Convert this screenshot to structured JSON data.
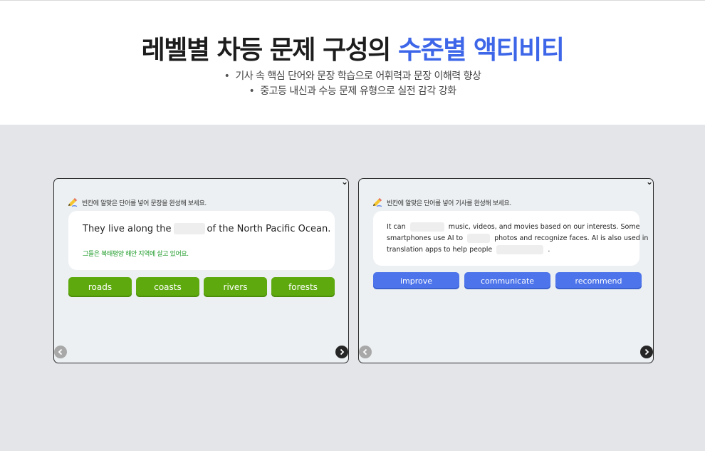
{
  "header": {
    "title_main": "레벨별 차등 문제 구성의",
    "title_accent": "수준별 액티비티",
    "bullets": [
      "기사 속 핵심 단어와 문장 학습으로 어휘력과 문장 이해력 향상",
      "중고등 내신과 수능 문제 유형으로 실전 감각 강화"
    ]
  },
  "activity_left": {
    "instruction": "빈칸에 알맞은 단어를 넣어 문장을 완성해 보세요.",
    "sentence_before": "They live along the",
    "sentence_after": "of the North Pacific Ocean.",
    "hint": "그들은 북태평양 해안 지역에 살고 있어요.",
    "options": [
      "roads",
      "coasts",
      "rivers",
      "forests"
    ]
  },
  "activity_right": {
    "instruction": "빈칸에 알맞은 단어를 넣어 기사를 완성해 보세요.",
    "passage": {
      "p1": "It can",
      "p2": "music, videos, and movies based on our interests. Some",
      "p3": "smartphones use AI to",
      "p4": "photos and recognize faces. AI is also used in",
      "p5": "translation apps to help people",
      "p6": "."
    },
    "options": [
      "improve",
      "communicate",
      "recommend"
    ]
  },
  "icons": {
    "instruction": "pencil-icon",
    "prev": "chevron-left-icon",
    "next": "chevron-right-icon",
    "corner": "chevron-down-icon"
  },
  "colors": {
    "accent": "#3d66e8",
    "green_button": "#5eaa0e",
    "blue_button": "#4d74ea",
    "hint_green": "#1f9c2a"
  }
}
